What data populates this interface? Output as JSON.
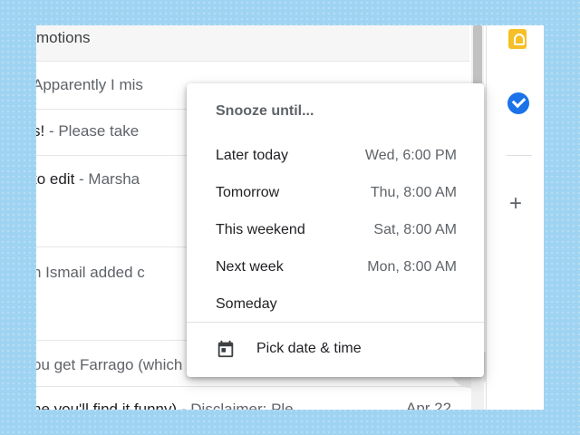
{
  "mail_list": {
    "category": "motions",
    "rows": [
      {
        "bold": "",
        "text": "Apparently I mis"
      },
      {
        "bold": "s!",
        "text": " - Please take"
      },
      {
        "bold": "to edit",
        "text": " - Marsha"
      },
      {
        "bold": "",
        "text": "n Ismail added c"
      },
      {
        "bold": "",
        "text": "ou get Farrago (which should..."
      },
      {
        "bold": "ne you'll find it funny)",
        "text": " - Disclaimer: Ple",
        "date": "Apr 22"
      }
    ]
  },
  "snooze_menu": {
    "title": "Snooze until...",
    "items": [
      {
        "label": "Later today",
        "time": "Wed, 6:00 PM"
      },
      {
        "label": "Tomorrow",
        "time": "Thu, 8:00 AM"
      },
      {
        "label": "This weekend",
        "time": "Sat, 8:00 AM"
      },
      {
        "label": "Next week",
        "time": "Mon, 8:00 AM"
      },
      {
        "label": "Someday",
        "time": ""
      }
    ],
    "pick": {
      "label": "Pick date & time",
      "icon": "calendar-icon"
    }
  },
  "hover_actions": {
    "icons": [
      "archive-icon",
      "delete-icon",
      "mark-as-read-icon",
      "snooze-clock-icon"
    ]
  },
  "side_panel": {
    "icons": [
      "keep-icon",
      "tasks-icon",
      "add-addon-icon"
    ],
    "add_glyph": "+"
  },
  "colors": {
    "background": "#9fd3f2",
    "keep": "#f6bf26",
    "tasks": "#1a73e8"
  }
}
